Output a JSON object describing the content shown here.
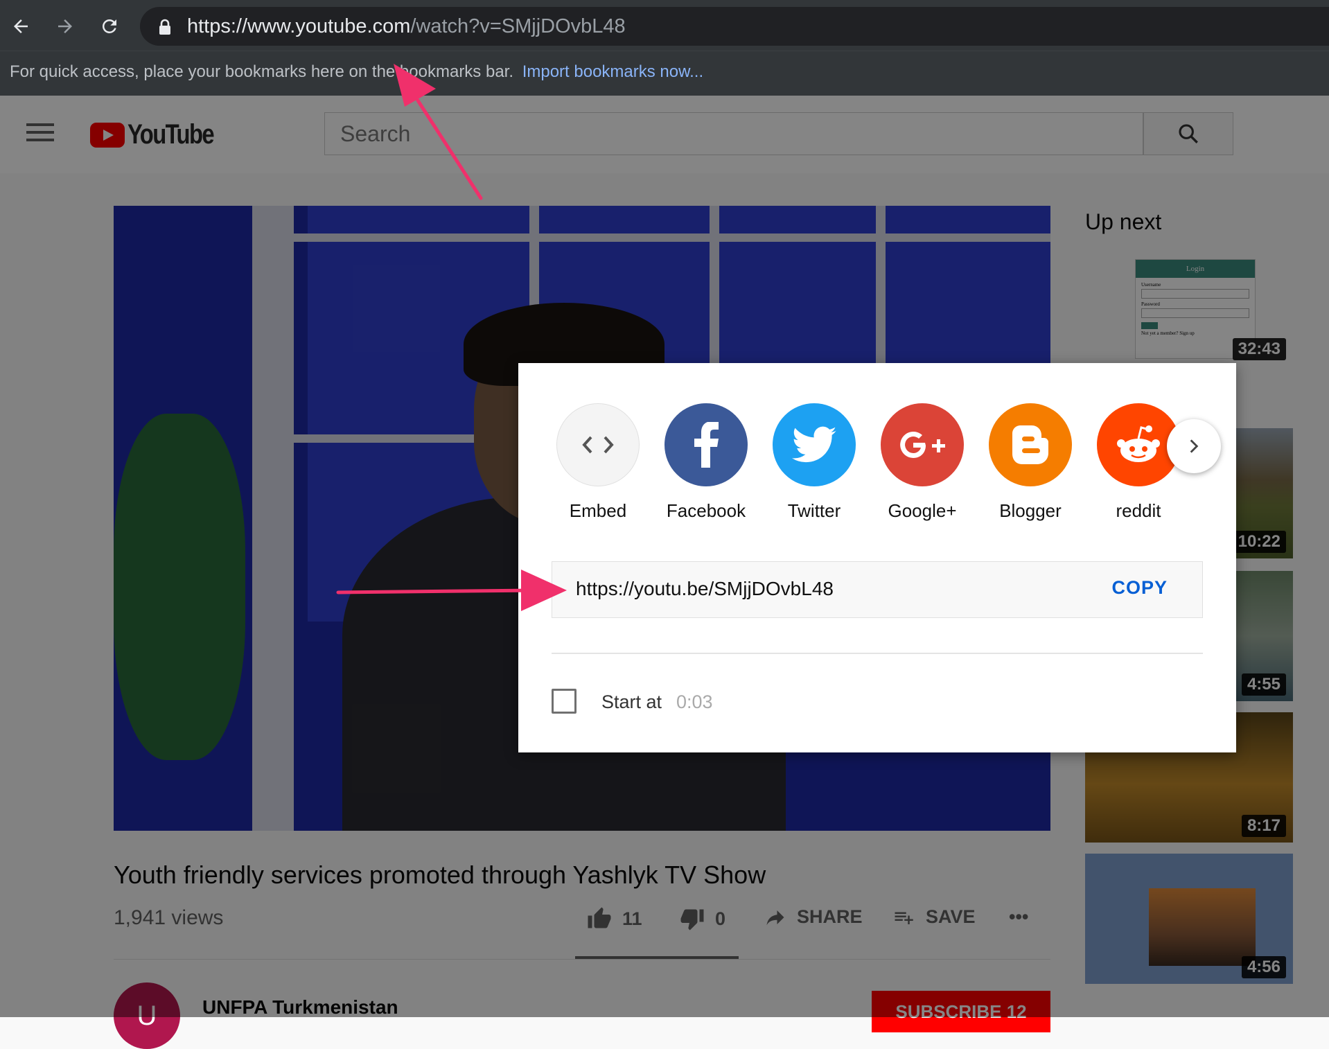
{
  "browser": {
    "url_host": "https://www.youtube.com",
    "url_path": "/watch?v=SMjjDOvbL48",
    "bookmarks_message": "For quick access, place your bookmarks here on the bookmarks bar.",
    "bookmarks_link": "Import bookmarks now..."
  },
  "header": {
    "logo_text": "YouTube",
    "search_placeholder": "Search"
  },
  "video": {
    "title": "Youth friendly services promoted through Yashlyk TV Show",
    "views": "1,941 views",
    "likes": "11",
    "dislikes": "0",
    "share_label": "SHARE",
    "save_label": "SAVE",
    "more_label": "•••"
  },
  "channel": {
    "avatar_letter": "U",
    "name": "UNFPA Turkmenistan",
    "subscribe_label": "SUBSCRIBE 12"
  },
  "sidebar": {
    "heading": "Up next",
    "thumb_login_title": "Login",
    "thumb_login_username": "Username",
    "thumb_login_password": "Password",
    "thumb_login_signup": "Not yet a member? Sign up",
    "durations": [
      "32:43",
      "10:22",
      "4:55",
      "8:17",
      "4:56"
    ]
  },
  "share_dialog": {
    "targets": [
      {
        "label": "Embed",
        "icon": "embed-code-icon",
        "color": "#f2f2f2"
      },
      {
        "label": "Facebook",
        "icon": "facebook-icon",
        "color": "#3b5998"
      },
      {
        "label": "Twitter",
        "icon": "twitter-bird-icon",
        "color": "#1da1f2"
      },
      {
        "label": "Google+",
        "icon": "google-plus-icon",
        "color": "#db4437"
      },
      {
        "label": "Blogger",
        "icon": "blogger-icon",
        "color": "#f57d00"
      },
      {
        "label": "reddit",
        "icon": "reddit-alien-icon",
        "color": "#ff4500"
      }
    ],
    "share_url": "https://youtu.be/SMjjDOvbL48",
    "copy_label": "COPY",
    "start_at_label": "Start at",
    "start_at_time": "0:03"
  },
  "colors": {
    "annotation_arrow": "#f0306b",
    "youtube_red": "#ff0000",
    "link_blue": "#065fd4"
  }
}
